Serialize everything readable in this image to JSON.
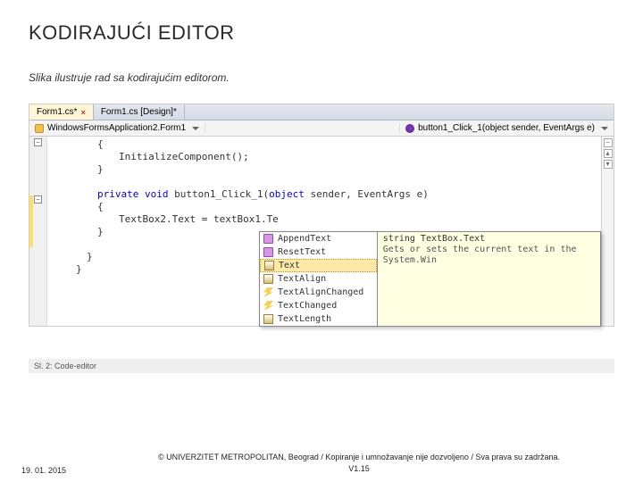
{
  "title": "KODIRAJUĆI EDITOR",
  "subtitle": "Slika ilustruje rad sa kodirajućim editorom.",
  "tabs": {
    "active": "Form1.cs*",
    "inactive": "Form1.cs [Design]*"
  },
  "breadcrumb": {
    "left": "WindowsFormsApplication2.Form1",
    "right": "button1_Click_1(object sender, EventArgs e)"
  },
  "code": {
    "l1": "{",
    "l2": "InitializeComponent();",
    "l3": "}",
    "l4_kw1": "private",
    "l4_kw2": "void",
    "l4_rest": " button1_Click_1(",
    "l4_kw3": "object",
    "l4_rest2": " sender, EventArgs e)",
    "l5": "{",
    "l6": "TextBox2.Text = textBox1.Te",
    "l7": "}",
    "l8": "}",
    "l9": "}"
  },
  "intellisense": {
    "items": [
      {
        "kind": "method",
        "label": "AppendText"
      },
      {
        "kind": "method",
        "label": "ResetText"
      },
      {
        "kind": "prop",
        "label": "Text",
        "selected": true
      },
      {
        "kind": "prop",
        "label": "TextAlign"
      },
      {
        "kind": "event",
        "label": "TextAlignChanged"
      },
      {
        "kind": "event",
        "label": "TextChanged"
      },
      {
        "kind": "prop",
        "label": "TextLength"
      }
    ],
    "tooltip_sig": "string TextBox.Text",
    "tooltip_desc": "Gets or sets the current text in the System.Win"
  },
  "caption": "Sl. 2: Code-editor",
  "footer": {
    "date": "19. 01. 2015",
    "copy1": "© UNIVERZITET METROPOLITAN, Beograd / Kopiranje i umnožavanje nije dozvoljeno / Sva prava su zadržana.",
    "copy2": "V1.15"
  }
}
